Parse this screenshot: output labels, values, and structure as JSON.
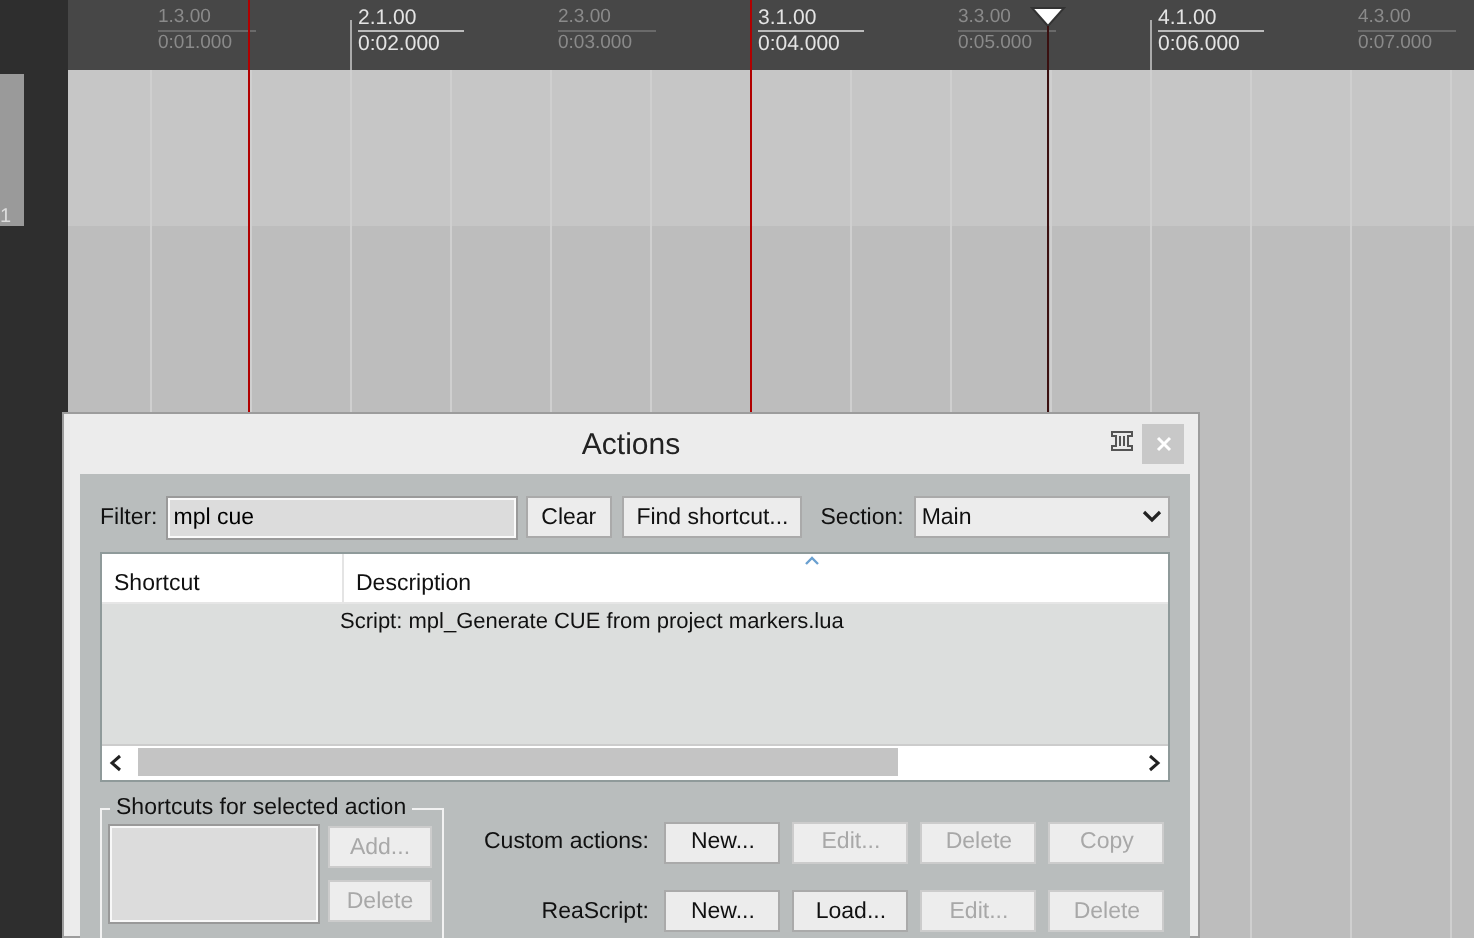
{
  "ruler": {
    "labels": [
      {
        "bar": "1.3.00",
        "time": "0:01.000",
        "major": false
      },
      {
        "bar": "2.1.00",
        "time": "0:02.000",
        "major": true
      },
      {
        "bar": "2.3.00",
        "time": "0:03.000",
        "major": false
      },
      {
        "bar": "3.1.00",
        "time": "0:04.000",
        "major": true
      },
      {
        "bar": "3.3.00",
        "time": "0:05.000",
        "major": false
      },
      {
        "bar": "4.1.00",
        "time": "0:06.000",
        "major": true
      },
      {
        "bar": "4.3.00",
        "time": "0:07.000",
        "major": false
      }
    ]
  },
  "track": {
    "number": "1"
  },
  "dialog": {
    "title": "Actions",
    "filter": {
      "label": "Filter:",
      "value": "mpl cue"
    },
    "buttons": [
      "Clear",
      "Find shortcut..."
    ],
    "section": {
      "label": "Section:",
      "value": "Main"
    },
    "table": {
      "columns": [
        {
          "label": "Shortcut",
          "sorted": false
        },
        {
          "label": "Description",
          "sorted": true
        }
      ],
      "rows": [
        {
          "description": "Script: mpl_Generate CUE from project markers.lua"
        }
      ]
    },
    "shortcuts_group": {
      "title": "Shortcuts for selected action",
      "buttons": [
        {
          "label": "Add...",
          "disabled": true
        },
        {
          "label": "Delete",
          "disabled": true
        }
      ]
    },
    "action_rows": [
      {
        "label": "Custom actions:",
        "buttons": [
          {
            "label": "New...",
            "disabled": false
          },
          {
            "label": "Edit...",
            "disabled": true
          },
          {
            "label": "Delete",
            "disabled": true
          },
          {
            "label": "Copy",
            "disabled": true
          }
        ]
      },
      {
        "label": "ReaScript:",
        "buttons": [
          {
            "label": "New...",
            "disabled": false
          },
          {
            "label": "Load...",
            "disabled": false
          },
          {
            "label": "Edit...",
            "disabled": true
          },
          {
            "label": "Delete",
            "disabled": true
          }
        ]
      }
    ]
  }
}
